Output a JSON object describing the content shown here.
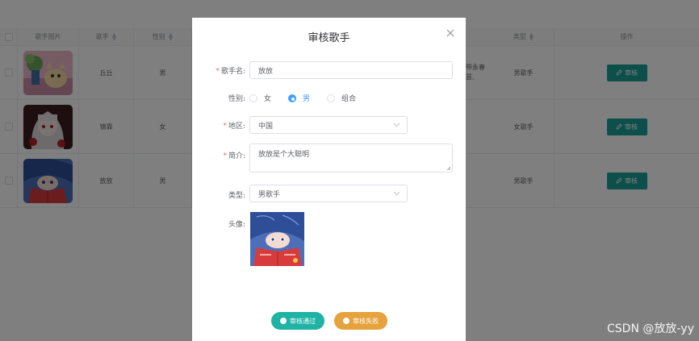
{
  "table": {
    "headers": {
      "image": "歌手图片",
      "singer": "歌手",
      "gender": "性别",
      "type": "类型",
      "action": "操作"
    },
    "rows": [
      {
        "singer": "丘丘",
        "gender": "男",
        "intro_fragment_1": "带永春芸,",
        "intro_fragment_2": "",
        "type": "男歌手",
        "action": "审核"
      },
      {
        "singer": "锦霏",
        "gender": "女",
        "intro_fragment_1": "",
        "intro_fragment_2": "",
        "type": "女歌手",
        "action": "审核"
      },
      {
        "singer": "放放",
        "gender": "男",
        "intro_fragment_1": "",
        "intro_fragment_2": "",
        "type": "男歌手",
        "action": "审核"
      }
    ]
  },
  "dialog": {
    "title": "审核歌手",
    "fields": {
      "name_label": "歌手名:",
      "name_value": "放放",
      "gender_label": "性别:",
      "gender_options": [
        "女",
        "男",
        "组合"
      ],
      "gender_selected": "男",
      "region_label": "地区:",
      "region_value": "中国",
      "intro_label": "简介:",
      "intro_value": "放放是个大聪明",
      "type_label": "类型:",
      "type_value": "男歌手",
      "avatar_label": "头像:"
    },
    "buttons": {
      "pass": "审核通过",
      "fail": "审核失败"
    }
  },
  "watermark": "CSDN @放放-yy",
  "colors": {
    "primary": "#409eff",
    "teal": "#1b9e94",
    "pass_button": "#1fb3a5",
    "fail_button": "#e6a23c",
    "required": "#f56c6c"
  }
}
